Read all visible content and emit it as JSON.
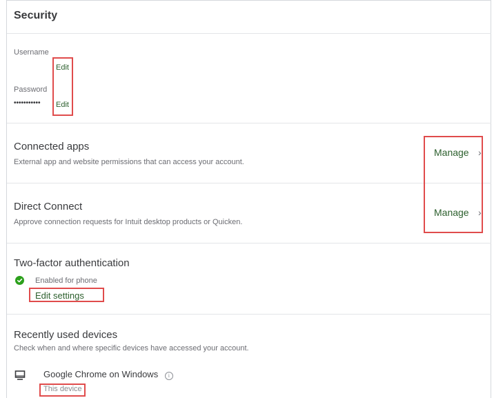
{
  "security": {
    "title": "Security",
    "username_label": "Username",
    "username_edit": "Edit",
    "password_label": "Password",
    "password_value": "•••••••••••",
    "password_edit": "Edit"
  },
  "connected_apps": {
    "title": "Connected apps",
    "description": "External app and website permissions that can access your account.",
    "action": "Manage"
  },
  "direct_connect": {
    "title": "Direct Connect",
    "description": "Approve connection requests for Intuit desktop products or Quicken.",
    "action": "Manage"
  },
  "two_factor": {
    "title": "Two-factor authentication",
    "status": "Enabled for phone",
    "action": "Edit settings"
  },
  "devices": {
    "title": "Recently used devices",
    "description": "Check when and where specific devices have accessed your account.",
    "items": [
      {
        "name": "Google Chrome on Windows",
        "info_icon": "i",
        "status": "This device"
      }
    ]
  },
  "colors": {
    "link": "#2c5f2d",
    "success": "#2ca01c",
    "highlight": "#e04b4b"
  }
}
